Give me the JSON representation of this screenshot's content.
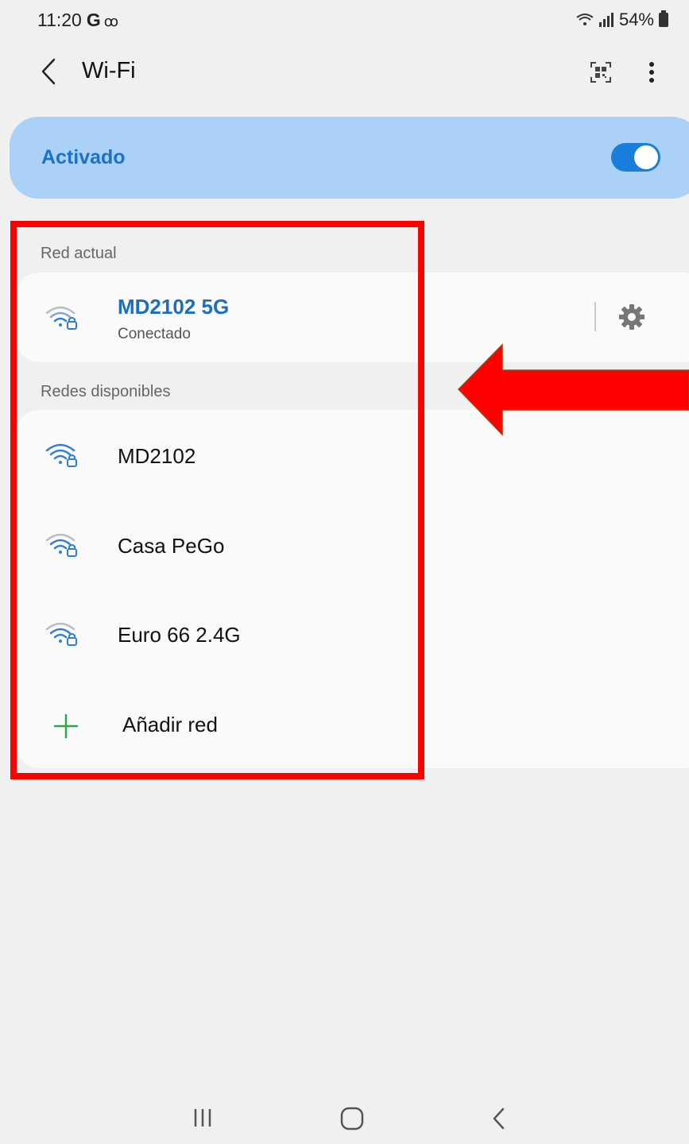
{
  "status_bar": {
    "time": "11:20",
    "carrier_letter": "G",
    "voicemail_symbol": "ꝏ",
    "battery": "54%"
  },
  "app_bar": {
    "title": "Wi-Fi",
    "back_icon": "chevron-left-icon",
    "qr_icon": "qr-code-icon",
    "more_icon": "more-vert-icon"
  },
  "toggle": {
    "label": "Activado",
    "state": "on",
    "accent": "#1a7fdc",
    "card_color": "#abd1f6"
  },
  "current_network": {
    "section_label": "Red actual",
    "name": "MD2102 5G",
    "status": "Conectado",
    "settings_icon": "gear-icon"
  },
  "available_networks": {
    "section_label": "Redes disponibles",
    "items": [
      {
        "name": "MD2102",
        "icon": "wifi-lock-icon"
      },
      {
        "name": "Casa PeGo",
        "icon": "wifi-lock-icon"
      },
      {
        "name": "Euro 66 2.4G",
        "icon": "wifi-lock-icon"
      }
    ],
    "add_label": "Añadir red",
    "add_icon": "plus-icon"
  },
  "annotation": {
    "box_color": "#ff0000",
    "arrow_color": "#ff0000"
  },
  "nav_bar": {
    "recents_icon": "recents-icon",
    "home_icon": "home-icon",
    "back_icon": "back-icon"
  }
}
